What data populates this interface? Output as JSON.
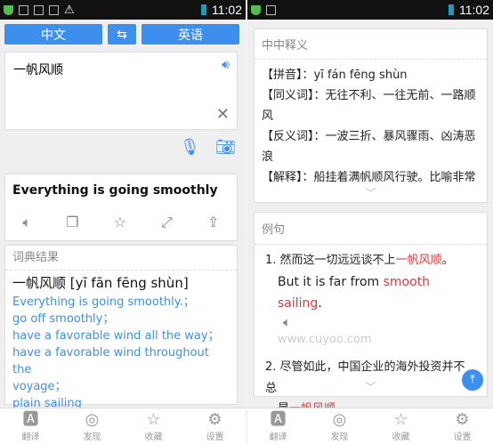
{
  "status": {
    "time": "11:02"
  },
  "left": {
    "lang_source": "中文",
    "lang_target": "英语",
    "swap_icon": "swap-icon",
    "input_value": "一帆风顺",
    "translation": "Everything is going smoothly",
    "dict": {
      "header": "词典结果",
      "headword": "一帆风顺 [yī fān fēng shùn]",
      "defs": [
        "Everything is going smoothly.；",
        "go off smoothly；",
        "have a favorable wind all the way；",
        "have a favorable wind throughout the",
        "voyage；",
        "plain sailing"
      ]
    }
  },
  "right": {
    "zh_card": {
      "header": "中中释义",
      "lines": [
        "【拼音】：yī fán fēng shùn",
        "【同义词】：无往不利、一往无前、一路顺",
        "风",
        "【反义词】：一波三折、暴风骤雨、凶涛恶",
        "浪",
        "【解释】：船挂着满帆顺风行驶。比喻非常"
      ]
    },
    "examples": {
      "header": "例句",
      "ex1": {
        "num": "1.",
        "zh_pre": "然而这一切远远谈不上",
        "zh_hl": "一帆风顺",
        "zh_post": "。",
        "en_pre": "But it is far from ",
        "en_hl": "smooth sailing",
        "en_post": ".",
        "source": "www.cuyoo.com"
      },
      "ex2": {
        "num": "2.",
        "zh_line1": "尽管如此，中国企业的海外投资并不总",
        "zh_pre": "是",
        "zh_hl": "一帆风顺",
        "zh_post": "。"
      }
    }
  },
  "nav": [
    {
      "label": "翻译"
    },
    {
      "label": "发现"
    },
    {
      "label": "收藏"
    },
    {
      "label": "设置"
    }
  ],
  "colors": {
    "accent": "#3d8fee",
    "highlight": "#d9383a"
  }
}
